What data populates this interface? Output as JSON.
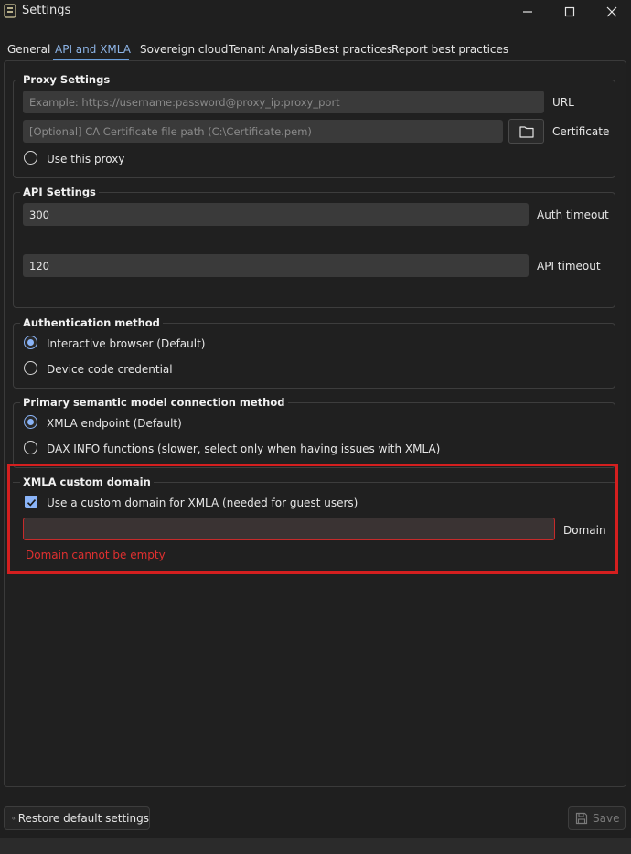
{
  "window": {
    "title": "Settings"
  },
  "tabs": [
    {
      "label": "General"
    },
    {
      "label": "API and XMLA"
    },
    {
      "label": "Sovereign cloud"
    },
    {
      "label": "Tenant Analysis"
    },
    {
      "label": "Best practices"
    },
    {
      "label": "Report best practices"
    }
  ],
  "proxy": {
    "title": "Proxy Settings",
    "url_placeholder": "Example: https://username:password@proxy_ip:proxy_port",
    "url_label": "URL",
    "cert_placeholder": "[Optional] CA Certificate file path (C:\\Certificate.pem)",
    "cert_label": "Certificate",
    "use_proxy_label": "Use this proxy"
  },
  "api": {
    "title": "API Settings",
    "auth_timeout_value": "300",
    "auth_timeout_label": "Auth timeout",
    "api_timeout_value": "120",
    "api_timeout_label": "API timeout"
  },
  "auth": {
    "title": "Authentication method",
    "options": [
      {
        "label": "Interactive browser (Default)",
        "checked": true
      },
      {
        "label": "Device code credential",
        "checked": false
      }
    ]
  },
  "semantic": {
    "title": "Primary semantic model connection method",
    "options": [
      {
        "label": "XMLA endpoint (Default)",
        "checked": true
      },
      {
        "label": "DAX INFO functions (slower, select only when having issues with XMLA)",
        "checked": false
      }
    ]
  },
  "xmla": {
    "title": "XMLA custom domain",
    "checkbox_label": "Use a custom domain for XMLA (needed for guest users)",
    "checkbox_checked": true,
    "domain_value": "",
    "domain_label": "Domain",
    "error": "Domain cannot be empty"
  },
  "footer": {
    "restore_label": "Restore default settings",
    "save_label": "Save"
  },
  "colors": {
    "accent": "#8ab4f8",
    "error": "#e03030",
    "highlight": "#d41f1f"
  }
}
